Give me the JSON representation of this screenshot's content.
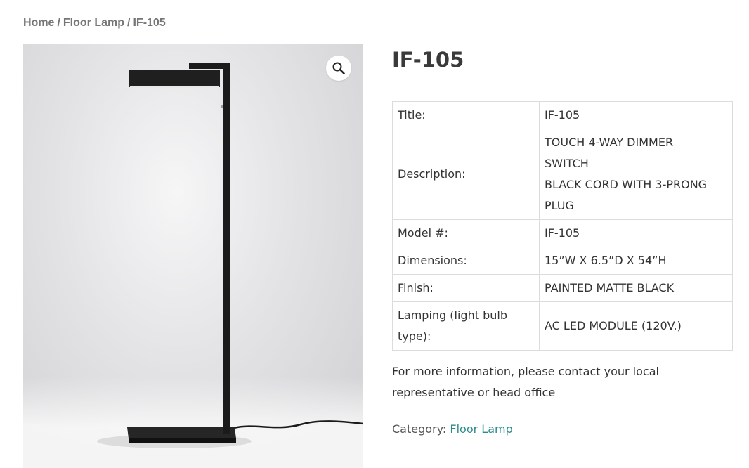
{
  "breadcrumb": {
    "home": "Home",
    "category": "Floor Lamp",
    "current": "IF-105",
    "separator": "/"
  },
  "gallery": {
    "image_alt": "IF-105 floor lamp",
    "zoom_icon": "magnifier-icon"
  },
  "product": {
    "title": "IF-105"
  },
  "specs": [
    {
      "label": "Title:",
      "value": "IF-105"
    },
    {
      "label": "Description:",
      "value_lines": [
        "TOUCH 4-WAY DIMMER",
        "SWITCH",
        "BLACK CORD WITH 3-PRONG",
        "PLUG"
      ]
    },
    {
      "label": "Model #:",
      "value": "IF-105"
    },
    {
      "label": "Dimensions:",
      "value": "15”W X 6.5”D X 54”H"
    },
    {
      "label": "Finish:",
      "value": "PAINTED MATTE BLACK"
    },
    {
      "label_lines": [
        "Lamping (light bulb",
        "type):"
      ],
      "value": "AC LED MODULE (120V.)"
    }
  ],
  "info": {
    "lines": [
      "For more information, please contact your local",
      "representative or head office"
    ]
  },
  "category": {
    "label": "Category:",
    "link": "Floor Lamp"
  },
  "colors": {
    "link_accent": "#2a8a8a",
    "breadcrumb": "#767676",
    "lamp": "#1b1b1b"
  }
}
